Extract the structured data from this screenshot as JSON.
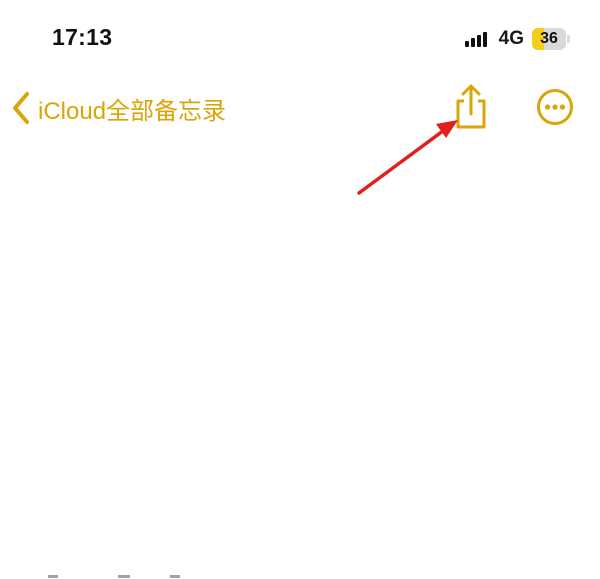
{
  "status_bar": {
    "time": "17:13",
    "network": "4G",
    "battery_level": 36,
    "battery_text": "36",
    "battery_color": "#f4cc1c"
  },
  "nav": {
    "back_label": "iCloud全部备忘录",
    "back_icon": "chevron-left-icon",
    "share_icon": "share-icon",
    "more_icon": "ellipsis-circle-icon"
  },
  "theme": {
    "accent": "#d9a507",
    "annotation": "#e02020"
  }
}
